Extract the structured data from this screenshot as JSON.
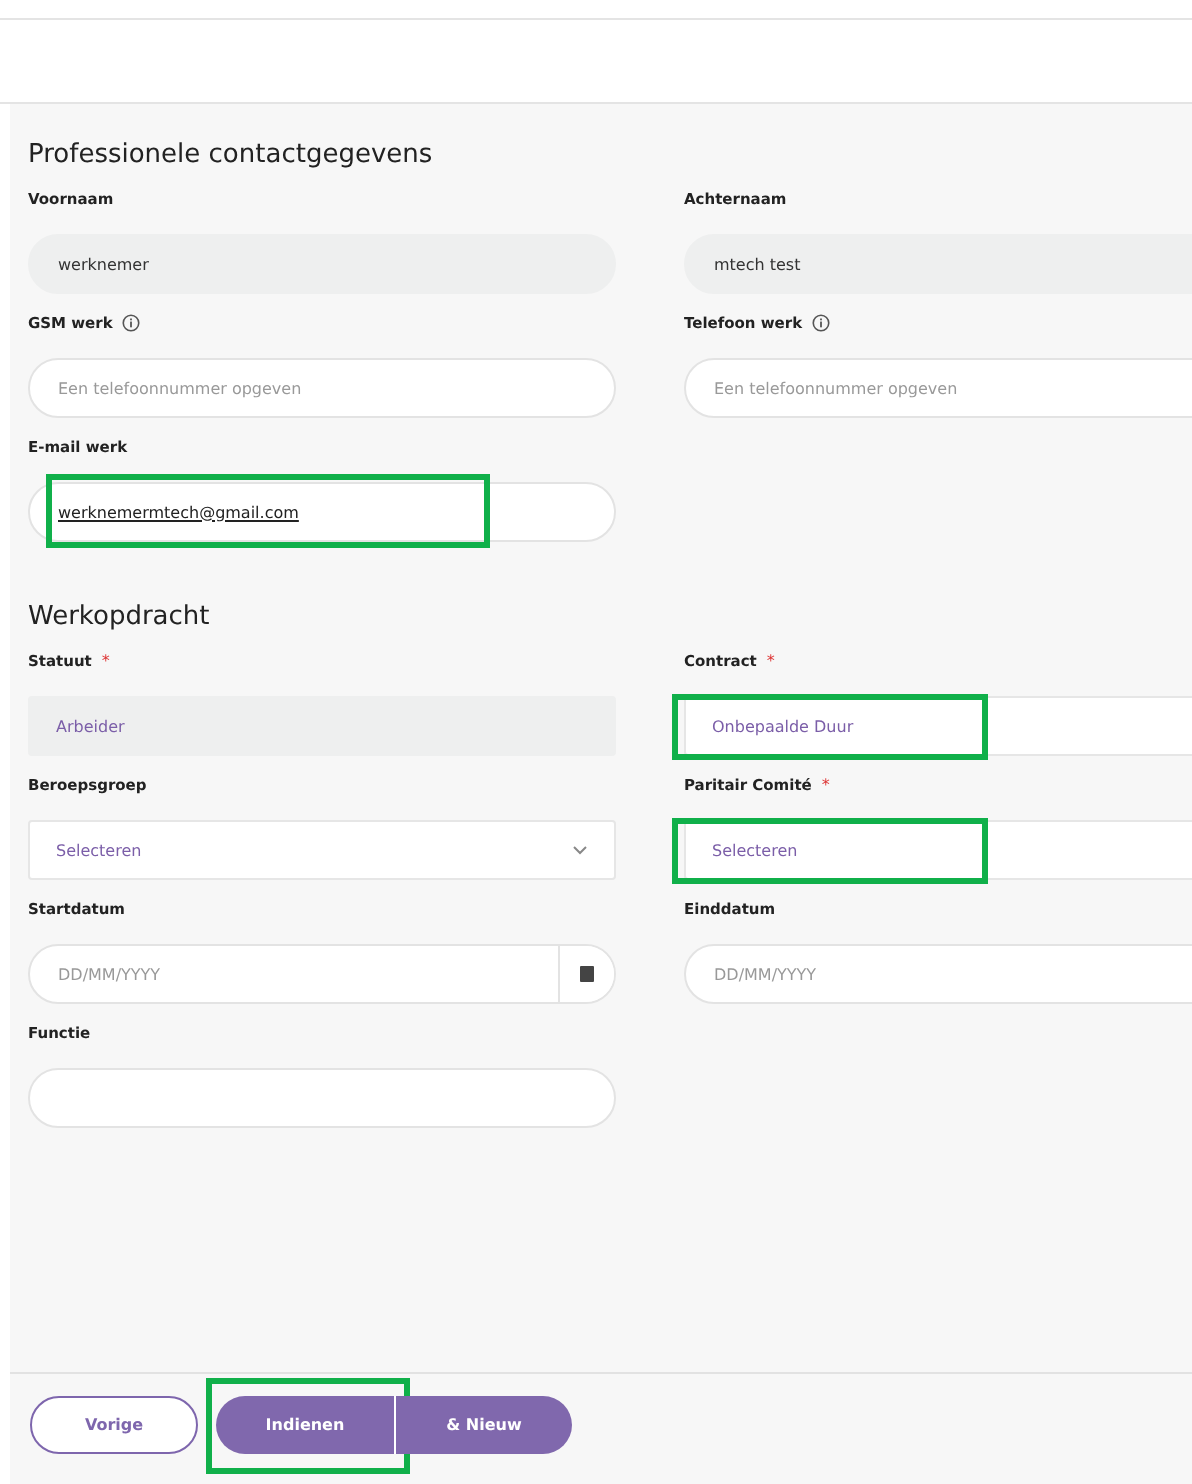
{
  "sections": [
    {
      "title": "Professionele contactgegevens",
      "rows": [
        [
          {
            "label": "Voornaam",
            "kind": "readonly",
            "value": "werknemer"
          },
          {
            "label": "Achternaam",
            "kind": "readonly",
            "value": "mtech test"
          }
        ],
        [
          {
            "label": "GSM werk",
            "info": true,
            "kind": "text",
            "placeholder": "Een telefoonnummer opgeven"
          },
          {
            "label": "Telefoon werk",
            "info": true,
            "kind": "text",
            "placeholder": "Een telefoonnummer opgeven"
          }
        ],
        [
          {
            "label": "E-mail werk",
            "kind": "text",
            "value": "werknemermtech@gmail.com",
            "highlighted": true
          }
        ]
      ]
    },
    {
      "title": "Werkopdracht",
      "rows": [
        [
          {
            "label": "Statuut",
            "required_mark": "*",
            "kind": "static",
            "value": "Arbeider"
          },
          {
            "label": "Contract",
            "required_mark": "*",
            "kind": "choice",
            "value": "Onbepaalde Duur",
            "highlighted": true
          }
        ],
        [
          {
            "label": "Beroepsgroep",
            "kind": "choice",
            "value": "Selecteren",
            "chevron": true
          },
          {
            "label": "Paritair Comité",
            "required_mark": "*",
            "kind": "choice",
            "value": "Selecteren",
            "highlighted": true
          }
        ],
        [
          {
            "label": "Startdatum",
            "kind": "date",
            "placeholder": "DD/MM/YYYY",
            "calendar": true
          },
          {
            "label": "Einddatum",
            "kind": "date",
            "placeholder": "DD/MM/YYYY"
          }
        ],
        [
          {
            "label": "Functie",
            "kind": "text"
          }
        ]
      ]
    }
  ],
  "buttons": [
    {
      "label": "Vorige",
      "kind": "outline"
    },
    {
      "label": "Indienen",
      "kind": "split-left",
      "highlighted": true
    },
    {
      "label": "& Nieuw",
      "kind": "split-right"
    }
  ]
}
